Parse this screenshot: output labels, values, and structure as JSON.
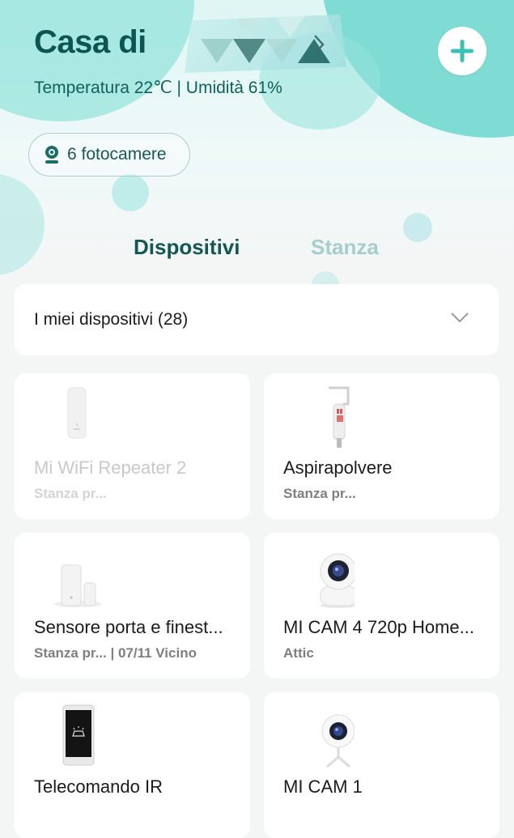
{
  "header": {
    "home_title": "Casa di",
    "weather": "Temperatura 22℃ | Umidità 61%"
  },
  "camera_chip": {
    "label": "6 fotocamere"
  },
  "tabs": [
    {
      "label": "Dispositivi",
      "active": true
    },
    {
      "label": "Stanza",
      "active": false
    }
  ],
  "device_filter": {
    "label": "I miei dispositivi (28)"
  },
  "devices": [
    {
      "name": "Mi WiFi Repeater 2",
      "room": "Stanza pr...",
      "offline": true,
      "icon": "wifi-repeater-icon"
    },
    {
      "name": "Aspirapolvere",
      "room": "Stanza pr...",
      "offline": false,
      "icon": "vacuum-icon"
    },
    {
      "name": "Sensore porta e finest...",
      "room": "Stanza pr...   | 07/11 Vicino",
      "offline": false,
      "icon": "door-sensor-icon"
    },
    {
      "name": "MI CAM 4 720p Home...",
      "room": "Attic",
      "offline": false,
      "icon": "ptz-camera-icon"
    },
    {
      "name": "Telecomando IR",
      "room": "",
      "offline": false,
      "icon": "ir-remote-icon"
    },
    {
      "name": "MI CAM 1",
      "room": "",
      "offline": false,
      "icon": "webcam-icon"
    }
  ],
  "colors": {
    "primary_dark": "#0c5552",
    "tab_inactive": "#a4cfcc",
    "accent_teal": "#7fdcd5",
    "card_bg": "#ffffff",
    "page_bg": "#f4f6f6"
  }
}
